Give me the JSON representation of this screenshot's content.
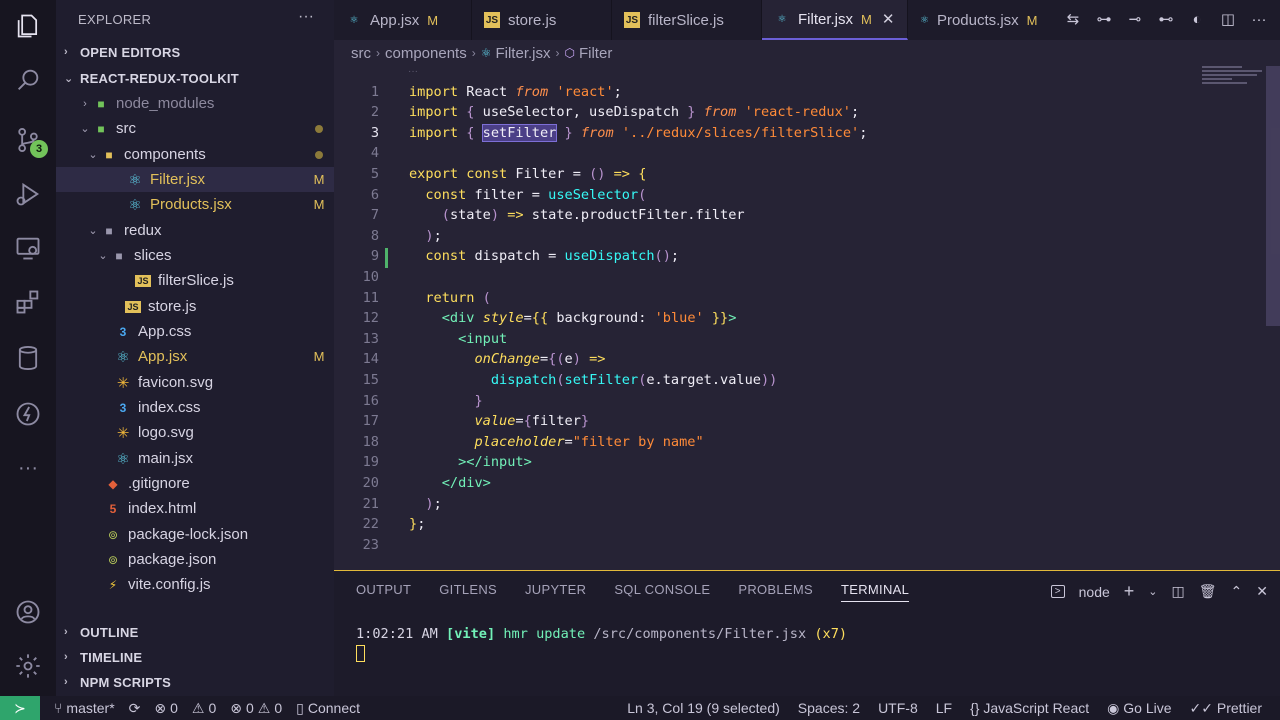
{
  "activity_bar": {
    "source_control_badge": "3",
    "icons": [
      "explorer-icon",
      "search-icon",
      "source-control-icon",
      "run-debug-icon",
      "remote-explorer-icon",
      "extensions-icon",
      "database-icon",
      "thunder-client-icon",
      "more-icon",
      "account-icon",
      "settings-gear-icon"
    ]
  },
  "sidebar": {
    "title": "EXPLORER",
    "more": "···",
    "sections": {
      "open_editors": "OPEN EDITORS",
      "project": "REACT-REDUX-TOOLKIT",
      "outline": "OUTLINE",
      "timeline": "TIMELINE",
      "npm_scripts": "NPM SCRIPTS"
    },
    "tree": [
      {
        "label": "node_modules",
        "chev": "›",
        "status": ""
      },
      {
        "label": "src",
        "chev": "⌄",
        "status": ""
      },
      {
        "label": "components",
        "chev": "⌄",
        "status": ""
      },
      {
        "label": "Filter.jsx",
        "chev": "",
        "status": "M"
      },
      {
        "label": "Products.jsx",
        "chev": "",
        "status": "M"
      },
      {
        "label": "redux",
        "chev": "⌄",
        "status": ""
      },
      {
        "label": "slices",
        "chev": "⌄",
        "status": ""
      },
      {
        "label": "filterSlice.js",
        "chev": "",
        "status": ""
      },
      {
        "label": "store.js",
        "chev": "",
        "status": ""
      },
      {
        "label": "App.css",
        "chev": "",
        "status": ""
      },
      {
        "label": "App.jsx",
        "chev": "",
        "status": "M"
      },
      {
        "label": "favicon.svg",
        "chev": "",
        "status": ""
      },
      {
        "label": "index.css",
        "chev": "",
        "status": ""
      },
      {
        "label": "logo.svg",
        "chev": "",
        "status": ""
      },
      {
        "label": "main.jsx",
        "chev": "",
        "status": ""
      },
      {
        "label": ".gitignore",
        "chev": "",
        "status": ""
      },
      {
        "label": "index.html",
        "chev": "",
        "status": ""
      },
      {
        "label": "package-lock.json",
        "chev": "",
        "status": ""
      },
      {
        "label": "package.json",
        "chev": "",
        "status": ""
      },
      {
        "label": "vite.config.js",
        "chev": "",
        "status": ""
      }
    ]
  },
  "tabs": [
    {
      "label": "App.jsx",
      "mod": "M"
    },
    {
      "label": "store.js",
      "mod": ""
    },
    {
      "label": "filterSlice.js",
      "mod": ""
    },
    {
      "label": "Filter.jsx",
      "mod": "M",
      "close": "✕"
    },
    {
      "label": "Products.jsx",
      "mod": "M"
    }
  ],
  "breadcrumb": {
    "a": "src",
    "b": "components",
    "c": "Filter.jsx",
    "d": "Filter"
  },
  "editor": {
    "fold_dots": "···",
    "line_numbers": [
      "1",
      "2",
      "3",
      "4",
      "5",
      "6",
      "7",
      "8",
      "9",
      "10",
      "11",
      "12",
      "13",
      "14",
      "15",
      "16",
      "17",
      "18",
      "19",
      "20",
      "21",
      "22",
      "23"
    ],
    "current_line": 3
  },
  "panel": {
    "tabs": [
      "OUTPUT",
      "GITLENS",
      "JUPYTER",
      "SQL CONSOLE",
      "PROBLEMS",
      "TERMINAL"
    ],
    "active_tab": "TERMINAL",
    "terminal_name": "node",
    "term_time": "1:02:21 AM",
    "term_tag": "[vite]",
    "term_msg": "hmr update",
    "term_path": "/src/components/Filter.jsx",
    "term_count": "(x7)"
  },
  "status": {
    "branch": "master*",
    "errors": "0",
    "warnings": "0",
    "info1": "0",
    "info2": "0",
    "connect": "Connect",
    "cursor": "Ln 3, Col 19 (9 selected)",
    "spaces": "Spaces: 2",
    "encoding": "UTF-8",
    "eol": "LF",
    "language": "JavaScript React",
    "golive": "Go Live",
    "prettier": "Prettier"
  }
}
